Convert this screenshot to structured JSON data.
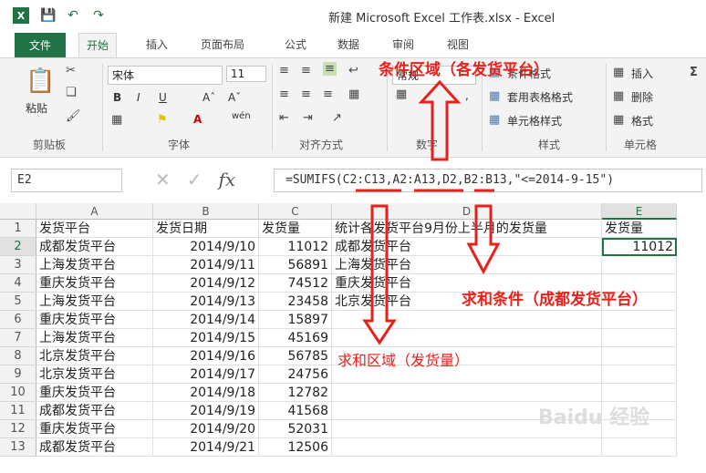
{
  "titlebar": {
    "title": "新建 Microsoft Excel 工作表.xlsx - Excel"
  },
  "tabs": [
    {
      "label": "文件"
    },
    {
      "label": "开始"
    },
    {
      "label": "插入"
    },
    {
      "label": "页面布局"
    },
    {
      "label": "公式"
    },
    {
      "label": "数据"
    },
    {
      "label": "审阅"
    },
    {
      "label": "视图"
    }
  ],
  "ribbon": {
    "clipboard_label": "剪贴板",
    "paste_label": "粘贴",
    "font_label": "字体",
    "font_name": "宋体",
    "font_size": "11",
    "align_label": "对齐方式",
    "number_label": "数字",
    "number_format": "常规",
    "styles_label": "样式",
    "cond_format": "条件格式",
    "table_format": "套用表格格式",
    "cell_styles": "单元格样式",
    "cells_label": "单元格",
    "insert": "插入",
    "delete": "删除",
    "format": "格式"
  },
  "formula_bar": {
    "name_box": "E2",
    "formula": "=SUMIFS(C2:C13,A2:A13,D2,B2:B13,\"<=2014-9-15\")"
  },
  "sheet": {
    "columns": [
      "A",
      "B",
      "C",
      "D",
      "E"
    ],
    "rows": [
      {
        "n": "1",
        "a": "发货平台",
        "b": "发货日期",
        "c": "发货量",
        "d": "统计各发货平台9月份上半月的发货量",
        "e": "发货量"
      },
      {
        "n": "2",
        "a": "成都发货平台",
        "b": "2014/9/10",
        "c": "11012",
        "d": "成都发货平台",
        "e": "11012"
      },
      {
        "n": "3",
        "a": "上海发货平台",
        "b": "2014/9/11",
        "c": "56891",
        "d": "上海发货平台",
        "e": ""
      },
      {
        "n": "4",
        "a": "重庆发货平台",
        "b": "2014/9/12",
        "c": "74512",
        "d": "重庆发货平台",
        "e": ""
      },
      {
        "n": "5",
        "a": "上海发货平台",
        "b": "2014/9/13",
        "c": "23458",
        "d": "北京发货平台",
        "e": ""
      },
      {
        "n": "6",
        "a": "重庆发货平台",
        "b": "2014/9/14",
        "c": "15897",
        "d": "",
        "e": ""
      },
      {
        "n": "7",
        "a": "上海发货平台",
        "b": "2014/9/15",
        "c": "45169",
        "d": "",
        "e": ""
      },
      {
        "n": "8",
        "a": "北京发货平台",
        "b": "2014/9/16",
        "c": "56785",
        "d": "",
        "e": ""
      },
      {
        "n": "9",
        "a": "北京发货平台",
        "b": "2014/9/17",
        "c": "24756",
        "d": "",
        "e": ""
      },
      {
        "n": "10",
        "a": "重庆发货平台",
        "b": "2014/9/18",
        "c": "12782",
        "d": "",
        "e": ""
      },
      {
        "n": "11",
        "a": "成都发货平台",
        "b": "2014/9/19",
        "c": "41568",
        "d": "",
        "e": ""
      },
      {
        "n": "12",
        "a": "重庆发货平台",
        "b": "2014/9/20",
        "c": "52031",
        "d": "",
        "e": ""
      },
      {
        "n": "13",
        "a": "成都发货平台",
        "b": "2014/9/21",
        "c": "12506",
        "d": "",
        "e": ""
      }
    ]
  },
  "annotations": {
    "criteria_range": "条件区域（各发货平台）",
    "sum_criteria": "求和条件（成都发货平台）",
    "sum_range": "求和区域（发货量）"
  },
  "colors": {
    "accent": "#217346",
    "annotation": "#e8211b"
  }
}
